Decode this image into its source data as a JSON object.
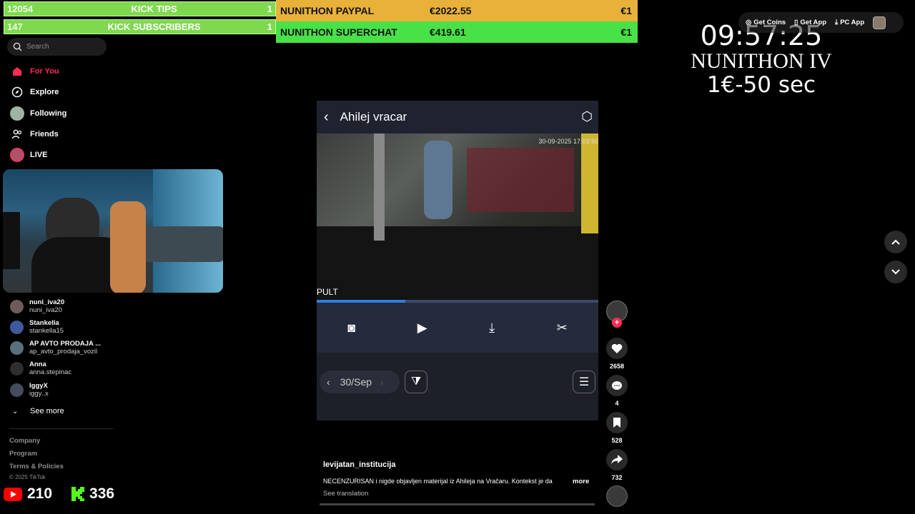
{
  "overlay": {
    "kick_tips": {
      "num": "12054",
      "label": "KICK TIPS",
      "count": "1"
    },
    "kick_subs": {
      "num": "147",
      "label": "KICK SUBSCRIBERS",
      "count": "1"
    },
    "paypal": {
      "label": "NUNITHON PAYPAL",
      "amount": "€2022.55",
      "step": "€1"
    },
    "superchat": {
      "label": "NUNITHON SUPERCHAT",
      "amount": "€419.61",
      "step": "€1"
    },
    "timer": "09:57:25",
    "event_title": "NUNITHON IV",
    "rate": "1€-50 sec",
    "youtube_count": "210",
    "kick_count": "336",
    "colors": {
      "paypal_bg": "#e8b23a",
      "superchat_bg": "#49e148",
      "kick_bar": "#7fd94f",
      "accent": "#fe2c55"
    }
  },
  "topbar": {
    "get_coins": "Get Coins",
    "get_app": "Get App",
    "pc_app": "PC App"
  },
  "sidebar": {
    "search_placeholder": "Search",
    "nav": [
      {
        "label": "For You",
        "icon": "home-icon"
      },
      {
        "label": "Explore",
        "icon": "compass-icon"
      },
      {
        "label": "Following",
        "icon": "avatar"
      },
      {
        "label": "Friends",
        "icon": "friends-icon"
      },
      {
        "label": "LIVE",
        "icon": "avatar"
      }
    ],
    "following": [
      {
        "name": "nuni_iva20",
        "handle": "nuni_iva20"
      },
      {
        "name": "Stankella",
        "handle": "stankella15"
      },
      {
        "name": "AP AVTO PRODAJA ...",
        "handle": "ap_avto_prodaja_vozil"
      },
      {
        "name": "Anna",
        "handle": "anna.stepinac"
      },
      {
        "name": "IggyX",
        "handle": "iggy..x"
      }
    ],
    "see_more": "See more",
    "footer": [
      "Company",
      "Program",
      "Terms & Policies"
    ],
    "copyright": "© 2025 TikTok"
  },
  "video": {
    "app_title": "Ahilej vracar",
    "cctv_timestamp": "30-09-2025 17:03:50",
    "cctv_label": "PULT",
    "date_filter": "30/Sep",
    "author": "levijatan_institucija",
    "caption": "NECENZURISAN i nigde objavljen materijal iz Ahileja na Vračaru. Kontekst je da",
    "more": "more",
    "see_translation": "See translation",
    "progress": 0.0
  },
  "actions": {
    "likes": "2658",
    "comments": "4",
    "saves": "528",
    "shares": "732"
  }
}
